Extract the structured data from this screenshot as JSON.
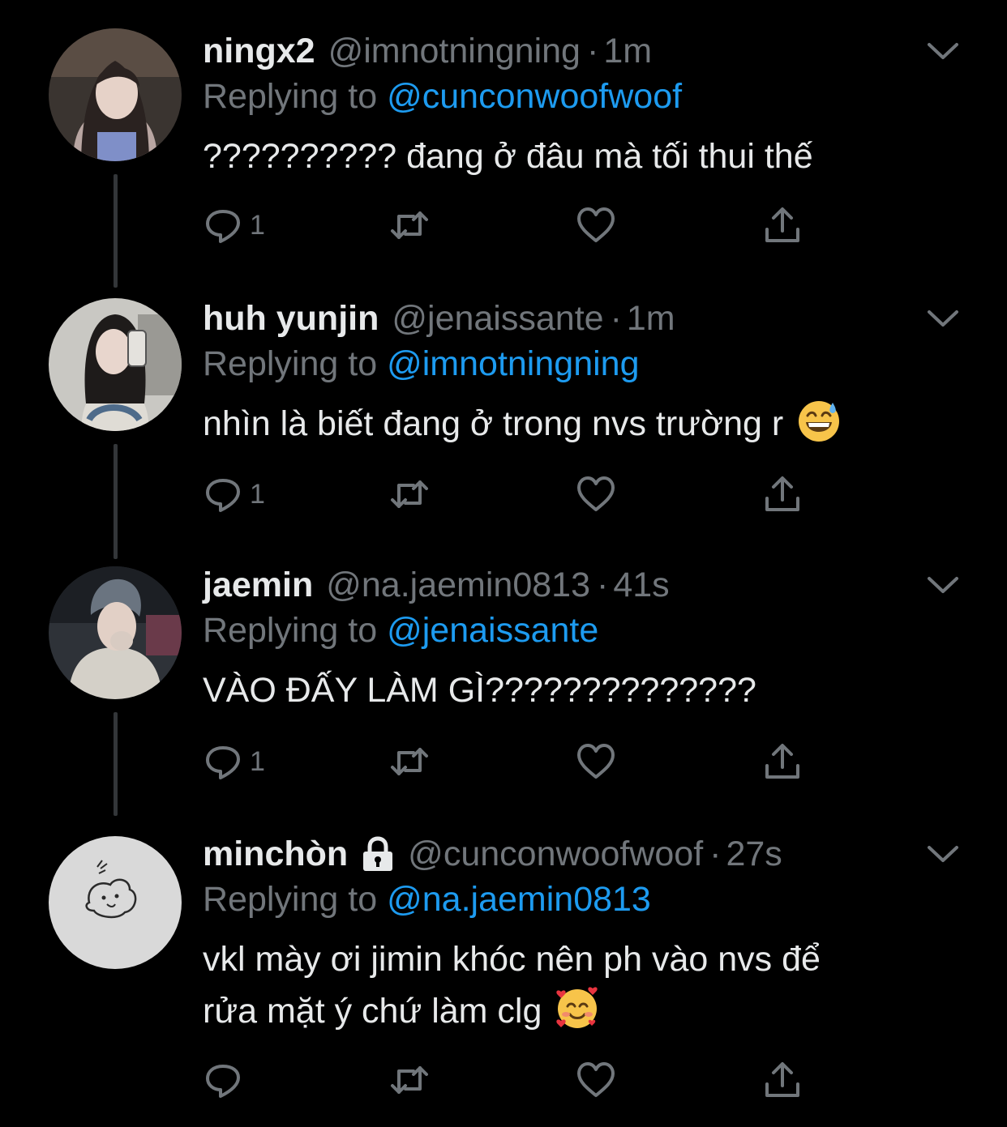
{
  "colors": {
    "background": "#000000",
    "text_primary": "#e7e9ea",
    "text_secondary": "#71767b",
    "link": "#1d9bf0",
    "thread_line": "#333639"
  },
  "tweets": [
    {
      "display_name": "ningx2",
      "handle": "@imnotningning",
      "separator": "·",
      "time": "1m",
      "replying_prefix": "Replying to",
      "replying_to": "@cunconwoofwoof",
      "text": "?????????? đang ở đâu mà tối thui thế",
      "reply_count": "1",
      "protected": false,
      "emoji": "",
      "text_line2": ""
    },
    {
      "display_name": "huh yunjin",
      "handle": "@jenaissante",
      "separator": "·",
      "time": "1m",
      "replying_prefix": "Replying to",
      "replying_to": "@imnotningning",
      "text": "nhìn là biết đang ở trong nvs trường r",
      "reply_count": "1",
      "protected": false,
      "emoji": "grinning-face-with-sweat",
      "text_line2": ""
    },
    {
      "display_name": "jaemin",
      "handle": "@na.jaemin0813",
      "separator": "·",
      "time": "41s",
      "replying_prefix": "Replying to",
      "replying_to": "@jenaissante",
      "text": "VÀO ĐẤY LÀM GÌ??????????????",
      "reply_count": "1",
      "protected": false,
      "emoji": "",
      "text_line2": ""
    },
    {
      "display_name": "minchòn",
      "handle": "@cunconwoofwoof",
      "separator": "·",
      "time": "27s",
      "replying_prefix": "Replying to",
      "replying_to": "@na.jaemin0813",
      "text": "vkl mày ơi jimin khóc nên ph vào nvs để",
      "text_line2": "rửa mặt ý chứ làm clg",
      "reply_count": "",
      "protected": true,
      "emoji": "smiling-face-with-hearts"
    }
  ],
  "icons": {
    "reply": "reply-icon",
    "retweet": "retweet-icon",
    "like": "heart-icon",
    "share": "share-icon",
    "more": "chevron-down-icon",
    "protected": "lock-icon"
  }
}
